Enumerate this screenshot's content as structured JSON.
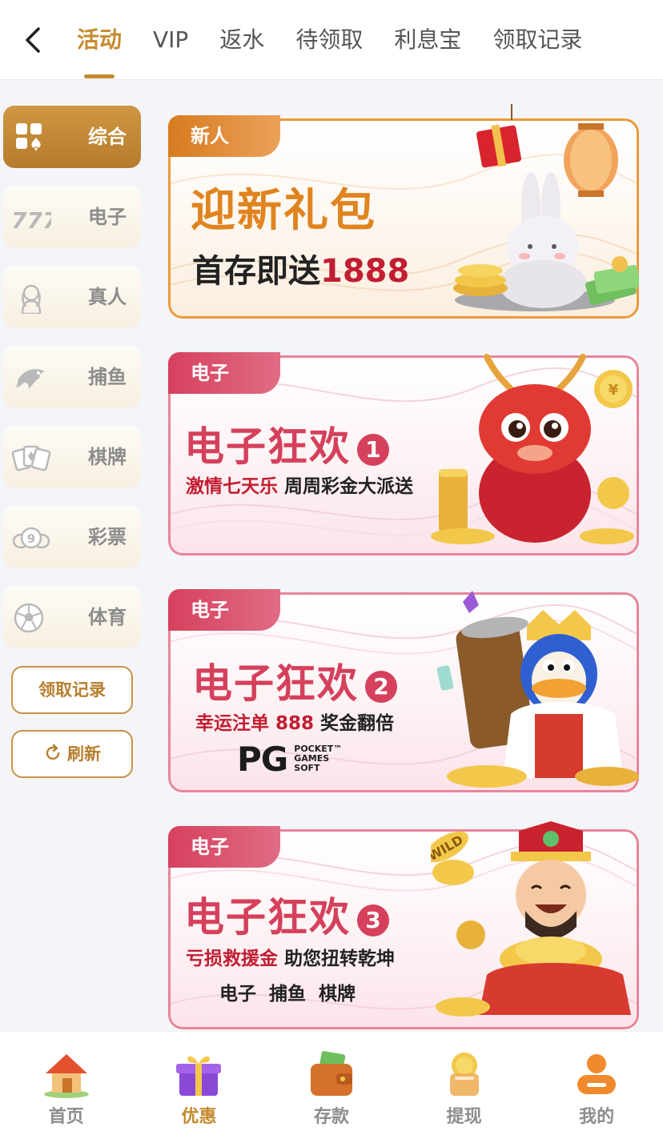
{
  "header": {
    "tabs": [
      {
        "label": "活动",
        "active": true
      },
      {
        "label": "VIP"
      },
      {
        "label": "返水"
      },
      {
        "label": "待领取"
      },
      {
        "label": "利息宝"
      },
      {
        "label": "领取记录"
      }
    ]
  },
  "sidebar": {
    "items": [
      {
        "label": "综合",
        "icon": "grid-cards-icon",
        "active": true
      },
      {
        "label": "电子",
        "icon": "slot-777-icon"
      },
      {
        "label": "真人",
        "icon": "live-dealer-icon"
      },
      {
        "label": "捕鱼",
        "icon": "fish-icon"
      },
      {
        "label": "棋牌",
        "icon": "playing-cards-icon"
      },
      {
        "label": "彩票",
        "icon": "lottery-ball-icon"
      },
      {
        "label": "体育",
        "icon": "soccer-ball-icon"
      }
    ],
    "record_button": "领取记录",
    "refresh_button": "刷新"
  },
  "promos": [
    {
      "tag": "新人",
      "title": "迎新礼包",
      "subtitle_prefix": "首存即送",
      "subtitle_highlight": "1888",
      "theme": "orange",
      "art": "rabbit-lantern-gift"
    },
    {
      "tag": "电子",
      "title": "电子狂欢",
      "number": "1",
      "subtitle_highlight": "激情七天乐",
      "subtitle_rest": " 周周彩金大派送",
      "theme": "pink",
      "art": "red-dragon-coins"
    },
    {
      "tag": "电子",
      "title": "电子狂欢",
      "number": "2",
      "subtitle_highlight": "幸运注单 888",
      "subtitle_rest": " 奖金翻倍",
      "logo_big": "PG",
      "logo_small": [
        "POCKET™",
        "GAMES",
        "SOFT"
      ],
      "theme": "pink",
      "art": "penguin-king-coins"
    },
    {
      "tag": "电子",
      "title": "电子狂欢",
      "number": "3",
      "subtitle_highlight": "亏损救援金",
      "subtitle_rest": " 助您扭转乾坤",
      "extra": "电子  捕鱼  棋牌",
      "wild_label": "WILD",
      "theme": "pink",
      "art": "fortune-god-gold"
    }
  ],
  "bottom_nav": [
    {
      "label": "首页",
      "icon": "home-icon"
    },
    {
      "label": "优惠",
      "icon": "gift-icon",
      "active": true
    },
    {
      "label": "存款",
      "icon": "wallet-icon"
    },
    {
      "label": "提现",
      "icon": "withdraw-icon"
    },
    {
      "label": "我的",
      "icon": "profile-icon"
    }
  ],
  "colors": {
    "accent": "#c58a2e",
    "promo_pink": "#d5405c",
    "promo_orange": "#e0841f",
    "highlight_red": "#c21d31"
  }
}
